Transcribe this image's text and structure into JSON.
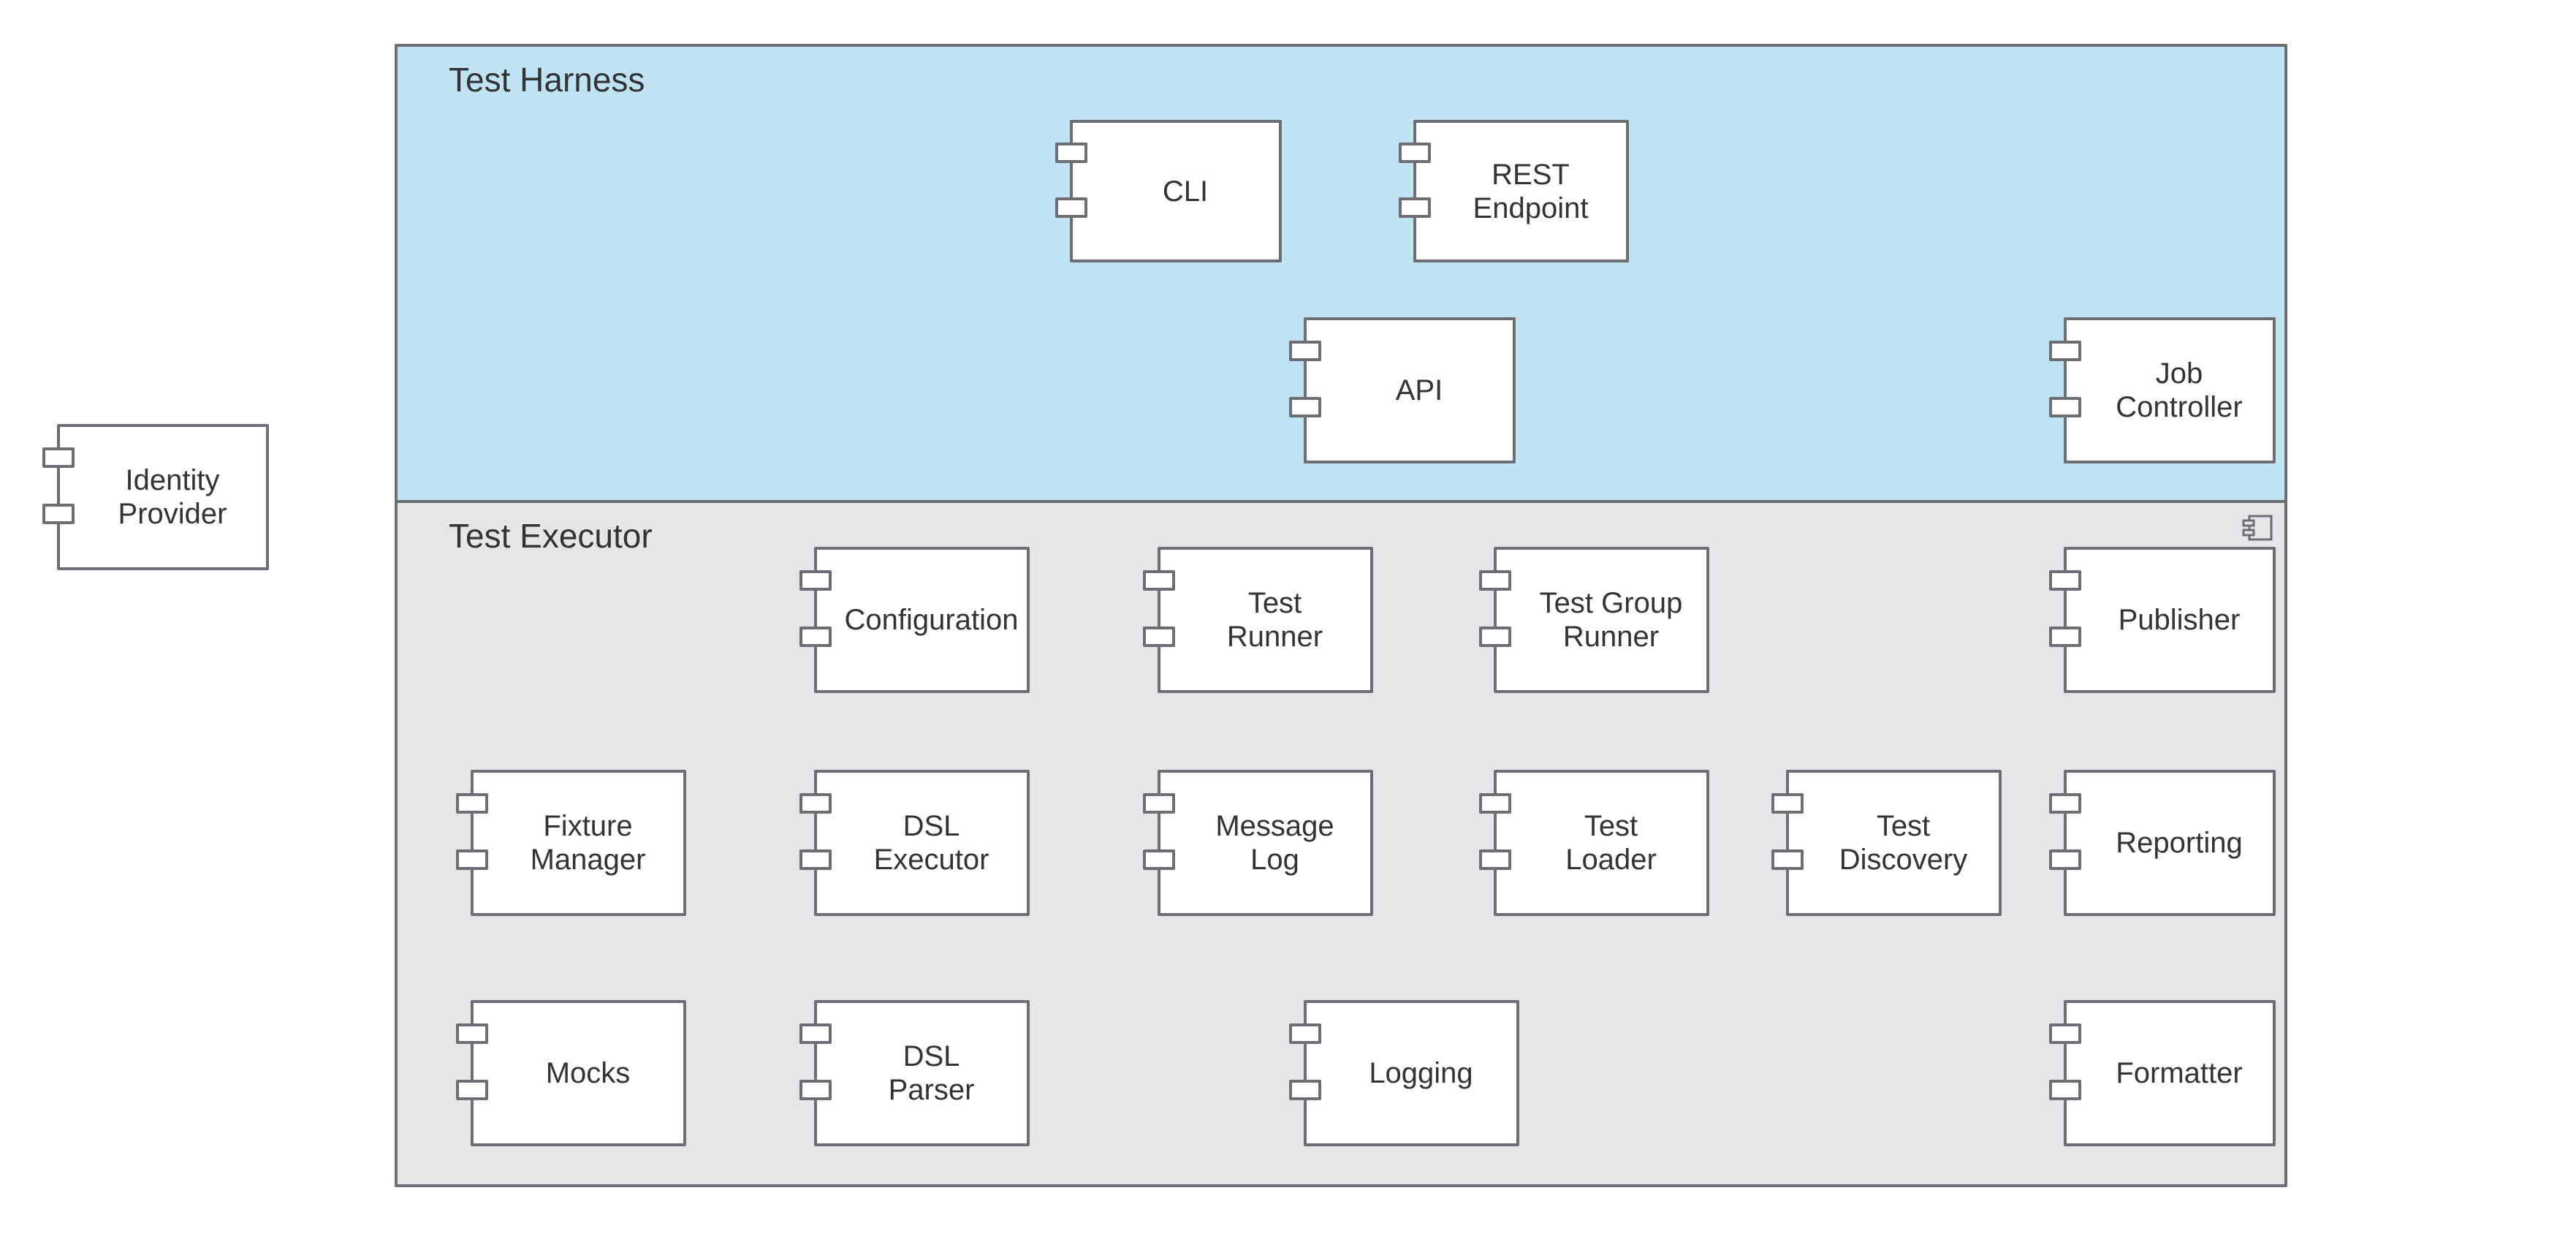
{
  "outside": {
    "identity_provider": "Identity\nProvider"
  },
  "harness": {
    "title": "Test Harness",
    "cli": "CLI",
    "rest_endpoint": "REST\nEndpoint",
    "api": "API",
    "job_controller": "Job\nController"
  },
  "executor": {
    "title": "Test Executor",
    "configuration": "Configuration",
    "test_runner": "Test\nRunner",
    "test_group_runner": "Test Group\nRunner",
    "publisher": "Publisher",
    "fixture_manager": "Fixture\nManager",
    "dsl_executor": "DSL\nExecutor",
    "message_log": "Message\nLog",
    "test_loader": "Test\nLoader",
    "test_discovery": "Test\nDiscovery",
    "reporting": "Reporting",
    "mocks": "Mocks",
    "dsl_parser": "DSL\nParser",
    "logging": "Logging",
    "formatter": "Formatter"
  },
  "colors": {
    "harness_bg": "#bfe3f2",
    "executor_bg": "#e4e6e8",
    "border": "#6b6f73"
  }
}
